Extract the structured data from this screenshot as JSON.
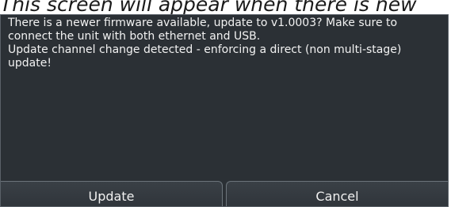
{
  "caption": "This screen will appear when there is new",
  "dialog": {
    "message_lines": [
      "There is a newer firmware available, update to v1.0003? Make sure to",
      "connect the unit with both ethernet and USB.",
      "Update channel change detected - enforcing a direct (non multi-stage)",
      "update!"
    ],
    "update_label": "Update",
    "cancel_label": "Cancel"
  }
}
